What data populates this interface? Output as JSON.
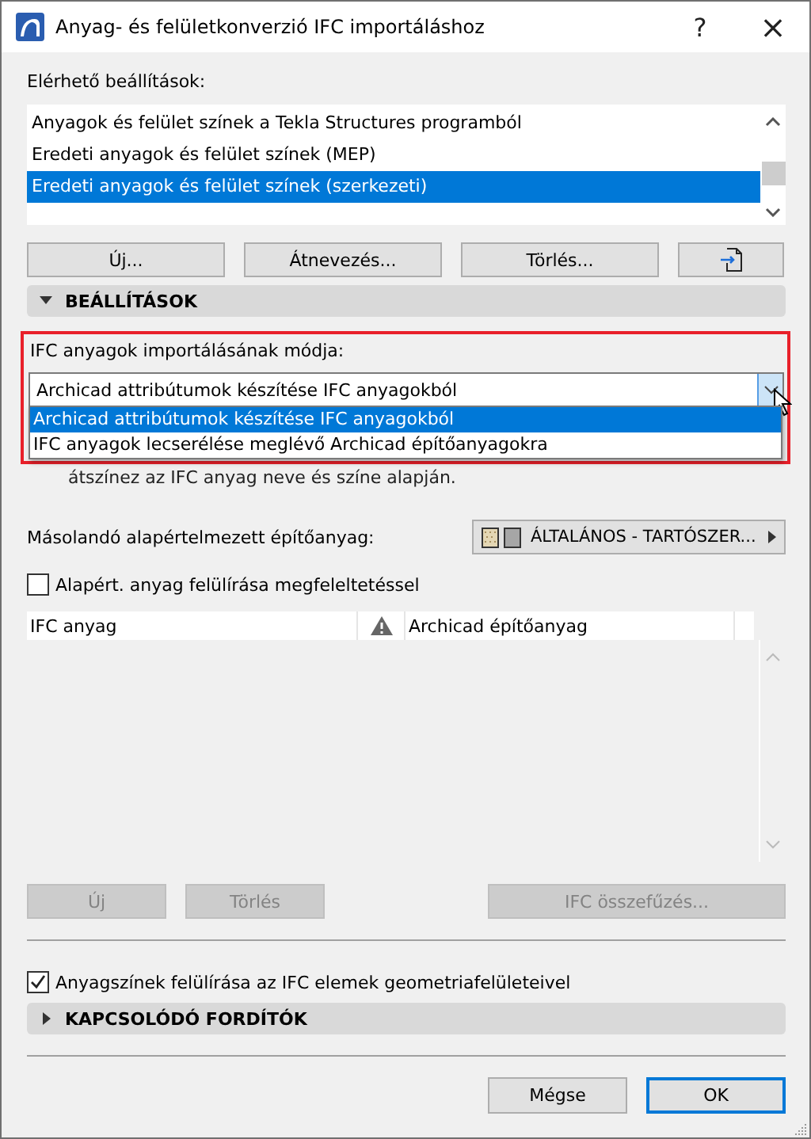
{
  "window": {
    "title": "Anyag- és felületkonverzió IFC importáláshoz",
    "help": "?",
    "close": "×"
  },
  "presets": {
    "label": "Elérhető beállítások:",
    "items": [
      {
        "label": "Anyagok és felület színek a Tekla Structures programból",
        "selected": false
      },
      {
        "label": "Eredeti anyagok és felület színek (MEP)",
        "selected": false
      },
      {
        "label": "Eredeti anyagok és felület színek (szerkezeti)",
        "selected": true
      }
    ]
  },
  "preset_buttons": [
    "Új...",
    "Átnevezés...",
    "Törlés..."
  ],
  "settings": {
    "title": "BEÁLLÍTÁSOK",
    "expanded": true,
    "mode_label": "IFC anyagok importálásának módja:",
    "mode_value": "Archicad attribútumok készítése IFC anyagokból",
    "mode_options": [
      {
        "label": "Archicad attribútumok készítése IFC anyagokból",
        "selected": true
      },
      {
        "label": "IFC anyagok lecserélése meglévő Archicad építőanyagokra",
        "selected": false
      }
    ],
    "note": "átszínez az IFC anyag neve és színe alapján.",
    "default_label": "Másolandó alapértelmezett építőanyag:",
    "default_value": "ÁLTALÁNOS - TARTÓSZER...",
    "override": {
      "label": "Alapért. anyag felülírása megfeleltetéssel",
      "checked": false
    },
    "columns": [
      "IFC anyag",
      "Archicad építőanyag"
    ],
    "table_buttons": [
      {
        "label": "Új",
        "disabled": true
      },
      {
        "label": "Törlés",
        "disabled": true
      },
      {
        "label": "IFC összefűzés...",
        "disabled": true
      }
    ]
  },
  "surface_override": {
    "label": "Anyagszínek felülírása az IFC elemek geometriafelületeivel",
    "checked": true
  },
  "translators": {
    "title": "KAPCSOLÓDÓ FORDÍTÓK",
    "expanded": false
  },
  "buttons": [
    {
      "label": "Mégse",
      "default": false
    },
    {
      "label": "OK",
      "default": true
    }
  ]
}
